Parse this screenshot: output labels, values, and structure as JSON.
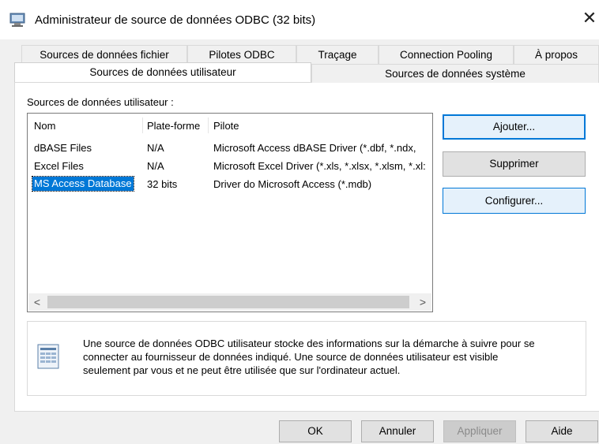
{
  "window": {
    "title": "Administrateur de source de données ODBC (32 bits)",
    "close_glyph": "✕",
    "icon": "odbc-admin-icon"
  },
  "tabs": {
    "row1": [
      {
        "label": "Sources de données fichier"
      },
      {
        "label": "Pilotes ODBC"
      },
      {
        "label": "Traçage"
      },
      {
        "label": "Connection Pooling"
      },
      {
        "label": "À propos"
      }
    ],
    "row2": [
      {
        "label": "Sources de données utilisateur",
        "active": true
      },
      {
        "label": "Sources de données système"
      }
    ]
  },
  "section_label": "Sources de données utilisateur :",
  "table": {
    "columns": [
      "Nom",
      "Plate-forme",
      "Pilote"
    ],
    "rows": [
      {
        "name": "dBASE Files",
        "platform": "N/A",
        "driver": "Microsoft Access dBASE Driver (*.dbf, *.ndx,"
      },
      {
        "name": "Excel Files",
        "platform": "N/A",
        "driver": "Microsoft Excel Driver (*.xls, *.xlsx, *.xlsm, *.xl:"
      },
      {
        "name": "MS Access Database",
        "platform": "32 bits",
        "driver": "Driver do Microsoft Access (*.mdb)",
        "selected": true
      }
    ],
    "scroll_left": "<",
    "scroll_right": ">"
  },
  "side_buttons": {
    "add": "Ajouter...",
    "remove": "Supprimer",
    "configure": "Configurer..."
  },
  "info": {
    "text_line1": "Une source de données ODBC utilisateur stocke des informations sur la démarche à suivre pour se",
    "text_line2": "connecter au fournisseur de données indiqué.   Une source de données utilisateur est visible",
    "text_line3": "seulement par vous et ne peut être utilisée que sur l'ordinateur actuel."
  },
  "footer_buttons": {
    "ok": "OK",
    "cancel": "Annuler",
    "apply": "Appliquer",
    "help": "Aide"
  },
  "colors": {
    "accent": "#0078d7",
    "dialog_bg": "#f0f0f0"
  }
}
